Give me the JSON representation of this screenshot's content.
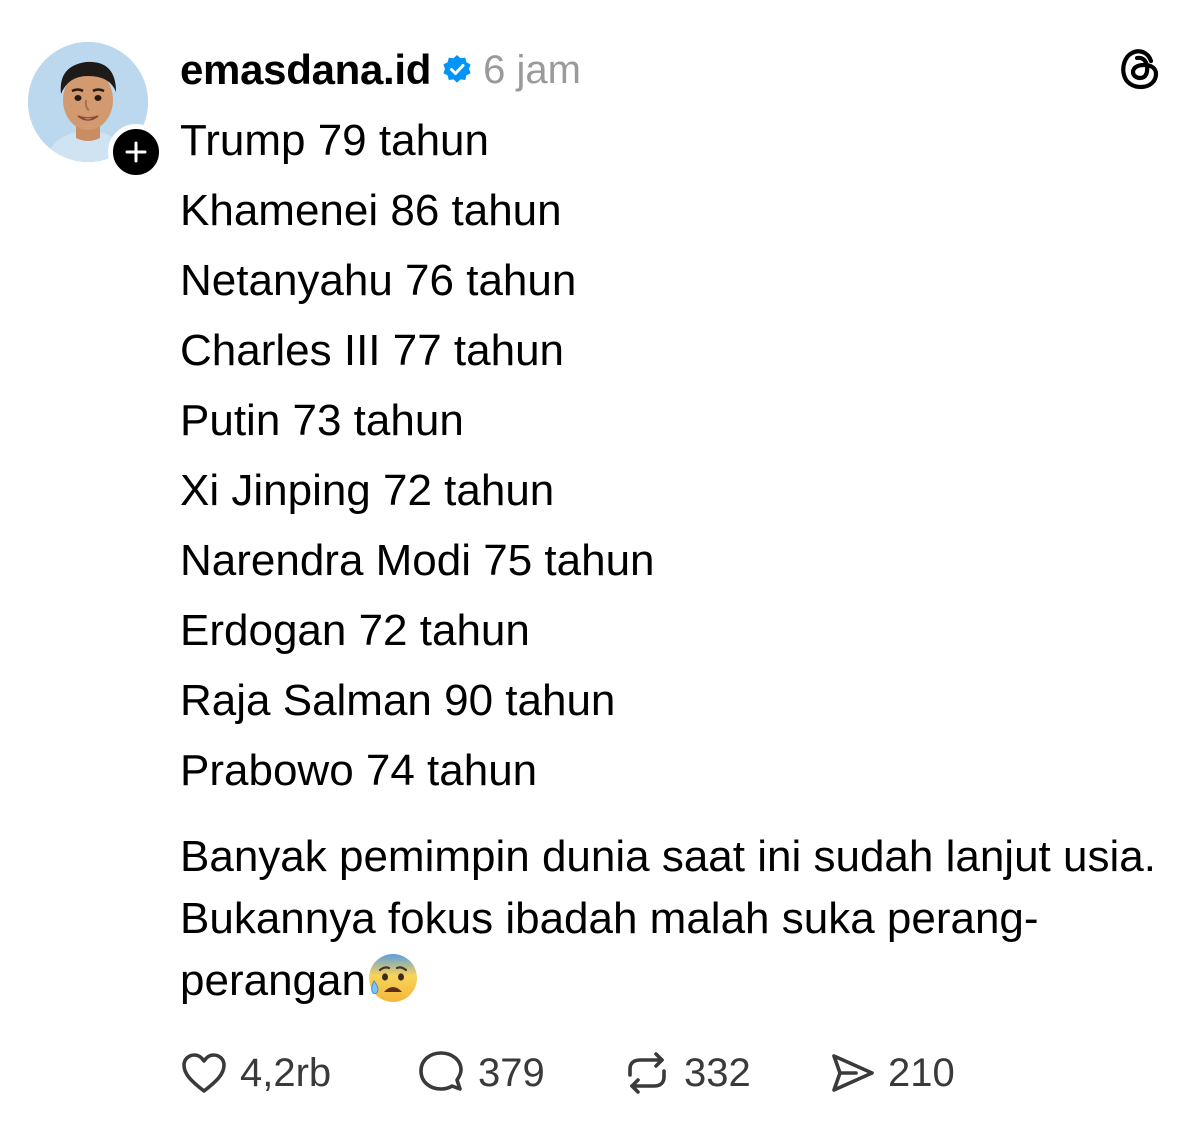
{
  "post": {
    "username": "emasdana.id",
    "timestamp": "6 jam",
    "lines": [
      "Trump 79 tahun",
      "Khamenei 86 tahun",
      "Netanyahu 76 tahun",
      "Charles III 77 tahun",
      "Putin 73 tahun",
      "Xi Jinping 72 tahun",
      "Narendra Modi 75 tahun",
      "Erdogan 72 tahun",
      "Raja Salman 90 tahun",
      "Prabowo 74 tahun"
    ],
    "paragraph": "Banyak pemimpin dunia saat ini sudah lanjut usia. Bukannya fokus ibadah malah suka perang-perangan",
    "emoji": "anxious-face-with-sweat"
  },
  "actions": {
    "likes": "4,2rb",
    "replies": "379",
    "reposts": "332",
    "shares": "210"
  },
  "icons": {
    "verified": "verified-badge-icon",
    "logo": "threads-logo-icon",
    "follow": "plus-icon",
    "like": "heart-icon",
    "reply": "comment-bubble-icon",
    "repost": "repost-icon",
    "share": "send-icon"
  },
  "colors": {
    "verified_blue": "#0095f6",
    "muted_text": "#9a9a9a"
  }
}
